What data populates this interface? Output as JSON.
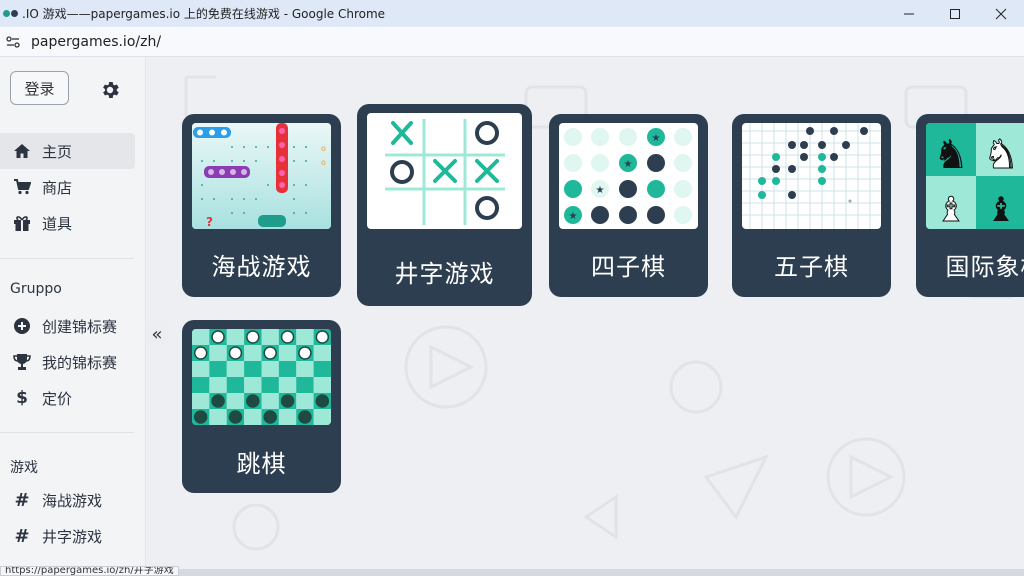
{
  "browser": {
    "window_title": ".IO 游戏——papergames.io 上的免费在线游戏 - Google Chrome",
    "url": "papergames.io/zh/",
    "status_url": "https://papergames.io/zh/井字游戏"
  },
  "sidebar": {
    "login_label": "登录",
    "nav": [
      {
        "label": "主页",
        "icon": "home-icon",
        "active": true
      },
      {
        "label": "商店",
        "icon": "cart-icon",
        "active": false
      },
      {
        "label": "道具",
        "icon": "gift-icon",
        "active": false
      }
    ],
    "group_title": "Gruppo",
    "group_items": [
      {
        "label": "创建锦标赛",
        "icon": "plus-circle-icon"
      },
      {
        "label": "我的锦标赛",
        "icon": "trophy-icon"
      },
      {
        "label": "定价",
        "icon": "dollar-icon"
      }
    ],
    "games_title": "游戏",
    "game_items": [
      {
        "label": "海战游戏",
        "icon": "hash-icon"
      },
      {
        "label": "井字游戏",
        "icon": "hash-icon"
      }
    ]
  },
  "games": [
    {
      "label": "海战游戏"
    },
    {
      "label": "井字游戏"
    },
    {
      "label": "四子棋"
    },
    {
      "label": "五子棋"
    },
    {
      "label": "国际象棋"
    },
    {
      "label": "跳棋"
    }
  ],
  "colors": {
    "card": "#2c3e50",
    "accent": "#1fb89a",
    "light_accent": "#9ee8d8"
  }
}
